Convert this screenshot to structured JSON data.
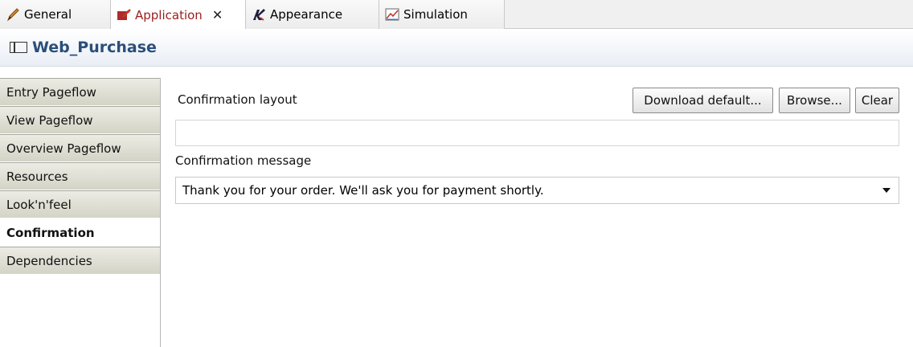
{
  "tabs": [
    {
      "label": "General",
      "icon": "pencil-icon",
      "active": false
    },
    {
      "label": "Application",
      "icon": "application-icon",
      "active": true,
      "close": "✕"
    },
    {
      "label": "Appearance",
      "icon": "appearance-icon",
      "active": false
    },
    {
      "label": "Simulation",
      "icon": "simulation-chart-icon",
      "active": false
    }
  ],
  "header": {
    "title": "Web_Purchase",
    "icon": "window-icon"
  },
  "nav": {
    "items": [
      "Entry Pageflow",
      "View Pageflow",
      "Overview Pageflow",
      "Resources",
      "Look'n'feel",
      "Confirmation",
      "Dependencies"
    ],
    "selected": "Confirmation"
  },
  "main": {
    "layout_label": "Confirmation layout",
    "buttons": {
      "download": "Download default...",
      "browse": "Browse...",
      "clear": "Clear"
    },
    "layout_value": "",
    "message_label": "Confirmation message",
    "message_value": "Thank you for your order.  We'll ask you for payment shortly."
  }
}
